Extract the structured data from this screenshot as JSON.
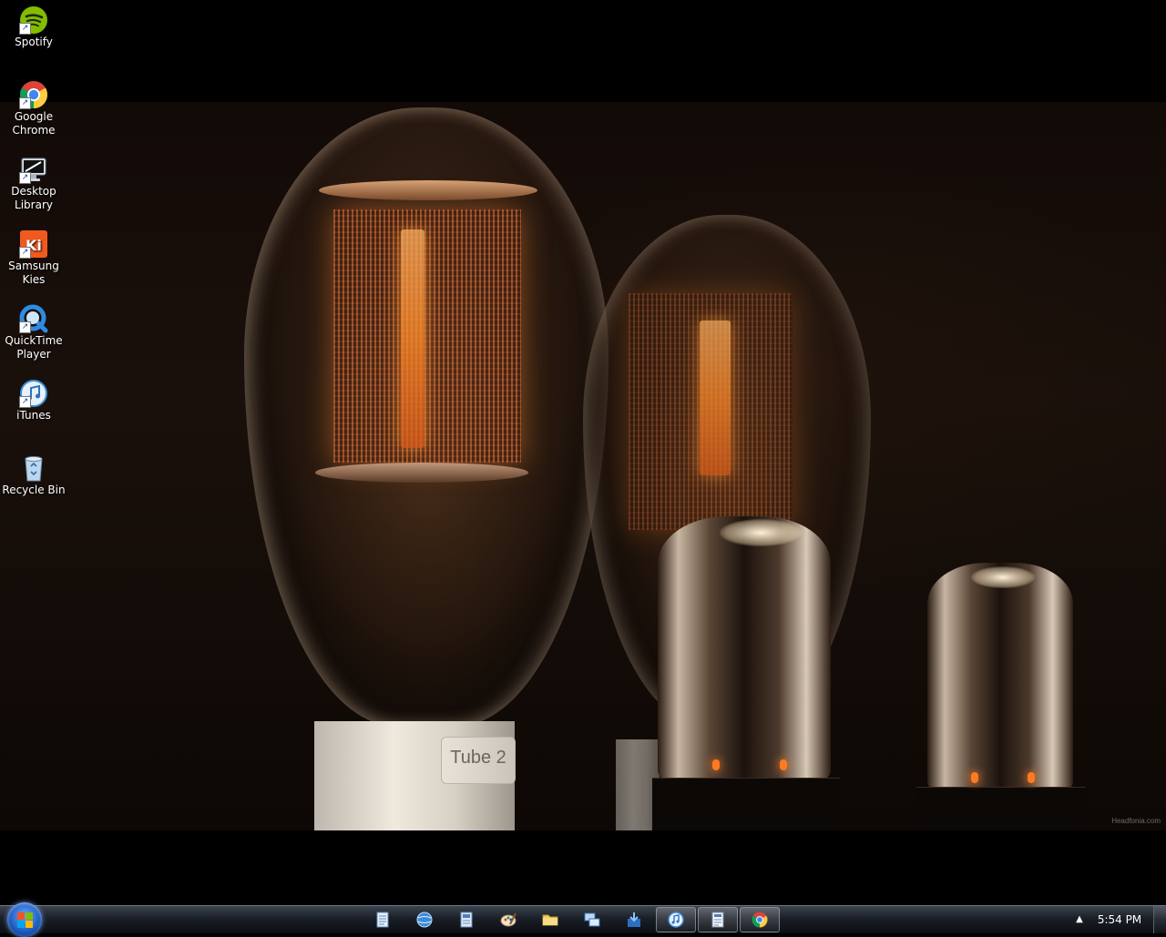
{
  "desktop_icons": [
    {
      "name": "spotify",
      "label": "Spotify",
      "icon": "spotify-icon",
      "color": "#84bd00"
    },
    {
      "name": "google-chrome",
      "label": "Google Chrome",
      "icon": "chrome-icon",
      "color": "#dd4b39"
    },
    {
      "name": "desktop-library",
      "label": "Desktop Library",
      "icon": "monitor-icon",
      "color": "#dfe7ee"
    },
    {
      "name": "samsung-kies",
      "label": "Samsung Kies",
      "icon": "kies-icon",
      "color": "#f05a1e"
    },
    {
      "name": "quicktime-player",
      "label": "QuickTime Player",
      "icon": "quicktime-icon",
      "color": "#2f8be0"
    },
    {
      "name": "itunes",
      "label": "iTunes",
      "icon": "itunes-icon",
      "color": "#3a8fd8"
    },
    {
      "name": "recycle-bin",
      "label": "Recycle Bin",
      "icon": "recycle-bin-icon",
      "color": "#bcd6ee"
    }
  ],
  "wallpaper": {
    "tube_label": "Tube 2",
    "watermark": "Headfonia.com"
  },
  "taskbar": {
    "start_icon": "windows-start-icon",
    "items": [
      {
        "name": "notepad",
        "icon": "notepad-icon",
        "running": false
      },
      {
        "name": "internet-app",
        "icon": "globe-icon",
        "running": false
      },
      {
        "name": "document",
        "icon": "document-icon",
        "running": false
      },
      {
        "name": "paint",
        "icon": "paint-icon",
        "running": false
      },
      {
        "name": "explorer",
        "icon": "folder-icon",
        "running": false
      },
      {
        "name": "network",
        "icon": "network-icon",
        "running": false
      },
      {
        "name": "installer",
        "icon": "install-icon",
        "running": false
      },
      {
        "name": "itunes",
        "icon": "itunes-icon",
        "running": true
      },
      {
        "name": "document-window",
        "icon": "document-icon",
        "running": true
      },
      {
        "name": "chrome",
        "icon": "chrome-icon",
        "running": true
      }
    ],
    "tray_chevron": "▲",
    "clock": "5:54 PM"
  }
}
